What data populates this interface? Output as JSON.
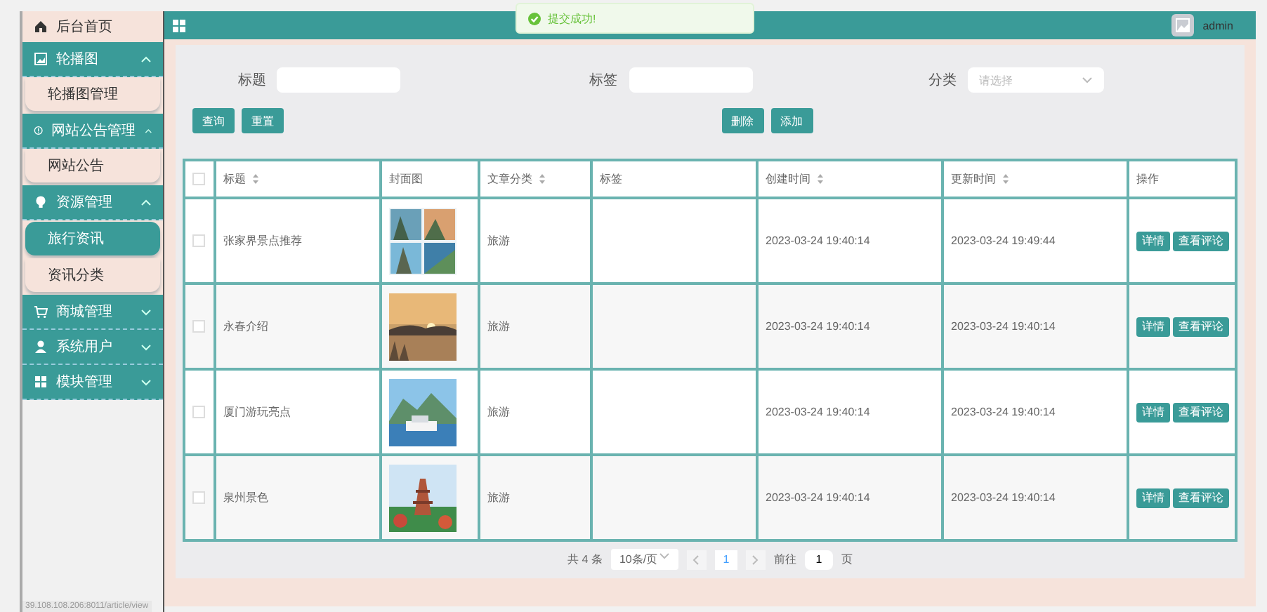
{
  "sidebar": {
    "items": [
      {
        "kind": "link",
        "label": "后台首页"
      },
      {
        "kind": "group",
        "label": "轮播图",
        "expanded": true,
        "children": [
          {
            "label": "轮播图管理",
            "selected": false
          }
        ]
      },
      {
        "kind": "group",
        "label": "网站公告管理",
        "expanded": true,
        "children": [
          {
            "label": "网站公告",
            "selected": false
          }
        ]
      },
      {
        "kind": "group",
        "label": "资源管理",
        "expanded": true,
        "children": [
          {
            "label": "旅行资讯",
            "selected": true
          },
          {
            "label": "资讯分类",
            "selected": false
          }
        ]
      },
      {
        "kind": "group",
        "label": "商城管理",
        "expanded": false
      },
      {
        "kind": "group",
        "label": "系统用户",
        "expanded": false
      },
      {
        "kind": "group",
        "label": "模块管理",
        "expanded": false
      }
    ]
  },
  "status_url": "39.108.108.206:8011/article/view",
  "header": {
    "user": "admin"
  },
  "toast": {
    "message": "提交成功!"
  },
  "search": {
    "fields": [
      {
        "label": "标题"
      },
      {
        "label": "标签"
      },
      {
        "label": "分类",
        "placeholder": "请选择"
      }
    ],
    "left_buttons": [
      "查询",
      "重置"
    ],
    "right_buttons": [
      "删除",
      "添加"
    ]
  },
  "table": {
    "select_all": {
      "checked": false
    },
    "columns": [
      {
        "label": "标题",
        "sortable": true
      },
      {
        "label": "封面图",
        "sortable": false
      },
      {
        "label": "文章分类",
        "sortable": true
      },
      {
        "label": "标签",
        "sortable": false
      },
      {
        "label": "创建时间",
        "sortable": true
      },
      {
        "label": "更新时间",
        "sortable": true
      },
      {
        "label": "操作",
        "sortable": false
      }
    ],
    "rows": [
      {
        "selected": false,
        "title": "张家界景点推荐",
        "cover": {
          "kind": "picture"
        },
        "category": "旅游",
        "created": "2023-03-24 19:40:14",
        "updated": "2023-03-24 19:49:44",
        "actions": [
          "详情",
          "查看评论"
        ]
      },
      {
        "selected": false,
        "title": "永春介绍",
        "cover": {
          "kind": "picture"
        },
        "category": "旅游",
        "created": "2023-03-24 19:40:14",
        "updated": "2023-03-24 19:40:14",
        "actions": [
          "详情",
          "查看评论"
        ]
      },
      {
        "selected": false,
        "title": "厦门游玩亮点",
        "cover": {
          "kind": "picture"
        },
        "category": "旅游",
        "created": "2023-03-24 19:40:14",
        "updated": "2023-03-24 19:40:14",
        "actions": [
          "详情",
          "查看评论"
        ]
      },
      {
        "selected": false,
        "title": "泉州景色",
        "cover": {
          "kind": "picture"
        },
        "category": "旅游",
        "created": "2023-03-24 19:40:14",
        "updated": "2023-03-24 19:40:14",
        "actions": [
          "详情",
          "查看评论"
        ]
      }
    ]
  },
  "pagination": {
    "total": "共 4 条",
    "page_size": "10条/页",
    "pages": [
      {
        "label": "1",
        "selected": true
      }
    ],
    "goto_label": "前往",
    "goto_value": "1",
    "goto_unit": "页"
  }
}
